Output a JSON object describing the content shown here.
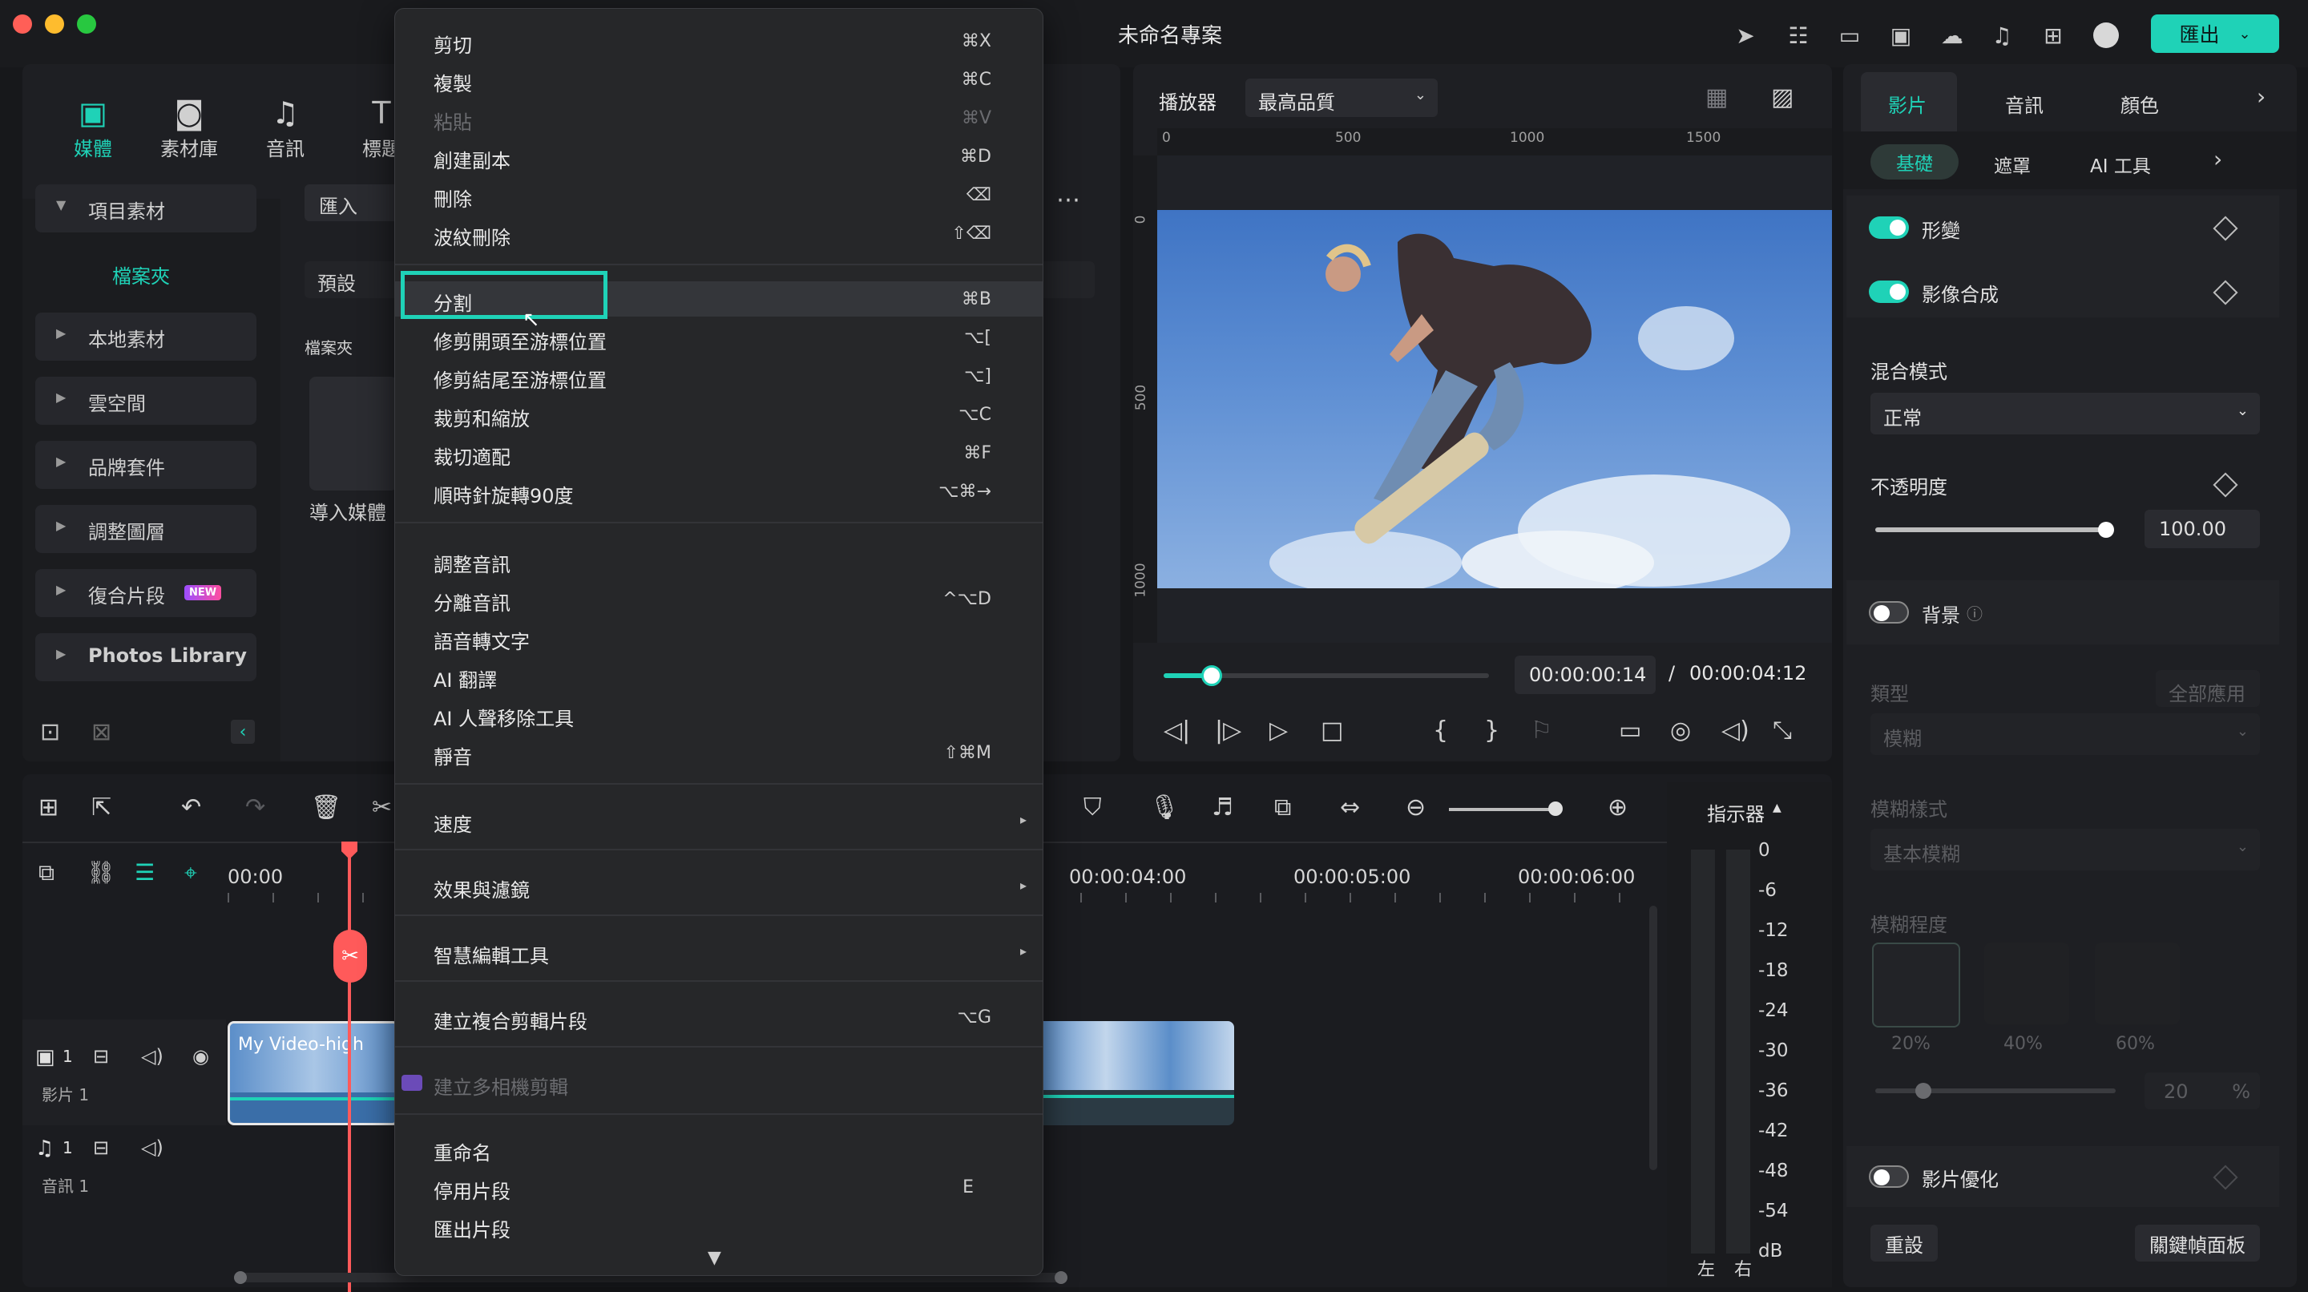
{
  "window": {
    "title": "未命名專案",
    "export_label": "匯出"
  },
  "media_tabs": [
    {
      "label": "媒體",
      "icon": "media-icon"
    },
    {
      "label": "素材庫",
      "icon": "stock-icon"
    },
    {
      "label": "音訊",
      "icon": "music-icon"
    },
    {
      "label": "標題",
      "icon": "title-icon"
    }
  ],
  "sidebar": {
    "project_media": "項目素材",
    "folder": "檔案夾",
    "items": [
      "本地素材",
      "雲空間",
      "品牌套件",
      "調整圖層",
      "復合片段",
      "Photos Library"
    ],
    "new_badge": "NEW"
  },
  "media_browser": {
    "import_label": "匯入",
    "preset_label": "預設",
    "folder_header": "檔案夾",
    "import_media": "導入媒體"
  },
  "context_menu": {
    "items": [
      {
        "label": "剪切",
        "shortcut": "⌘X"
      },
      {
        "label": "複製",
        "shortcut": "⌘C"
      },
      {
        "label": "粘貼",
        "shortcut": "⌘V"
      },
      {
        "label": "創建副本",
        "shortcut": "⌘D"
      },
      {
        "label": "刪除",
        "shortcut": "⌫"
      },
      {
        "label": "波紋刪除",
        "shortcut": "⇧⌫"
      },
      {
        "label": "分割",
        "shortcut": "⌘B"
      },
      {
        "label": "修剪開頭至游標位置",
        "shortcut": "⌥["
      },
      {
        "label": "修剪結尾至游標位置",
        "shortcut": "⌥]"
      },
      {
        "label": "裁剪和縮放",
        "shortcut": "⌥C"
      },
      {
        "label": "裁切適配",
        "shortcut": "⌘F"
      },
      {
        "label": "順時針旋轉90度",
        "shortcut": "⌥⌘→"
      },
      {
        "label": "調整音訊",
        "shortcut": ""
      },
      {
        "label": "分離音訊",
        "shortcut": "^⌥D"
      },
      {
        "label": "語音轉文字",
        "shortcut": ""
      },
      {
        "label": "AI 翻譯",
        "shortcut": ""
      },
      {
        "label": "AI 人聲移除工具",
        "shortcut": ""
      },
      {
        "label": "靜音",
        "shortcut": "⇧⌘M"
      },
      {
        "label": "速度",
        "shortcut": ""
      },
      {
        "label": "效果與濾鏡",
        "shortcut": ""
      },
      {
        "label": "智慧編輯工具",
        "shortcut": ""
      },
      {
        "label": "建立複合剪輯片段",
        "shortcut": "⌥G"
      },
      {
        "label": "建立多相機剪輯",
        "shortcut": ""
      },
      {
        "label": "重命名",
        "shortcut": ""
      },
      {
        "label": "停用片段",
        "shortcut": "E"
      },
      {
        "label": "匯出片段",
        "shortcut": ""
      }
    ],
    "more_arrow": "▼"
  },
  "player": {
    "label": "播放器",
    "quality": "最高品質",
    "ruler_top": [
      "0",
      "500",
      "1000",
      "1500"
    ],
    "ruler_left": [
      "0",
      "500",
      "1000"
    ],
    "current_time": "00:00:00:14",
    "separator": "/",
    "total_time": "00:00:04:12",
    "progress": 0.14
  },
  "inspector": {
    "tabs": [
      "影片",
      "音訊",
      "顏色"
    ],
    "subtabs": [
      "基礎",
      "遮罩",
      "AI 工具"
    ],
    "transform": "形變",
    "compositing": "影像合成",
    "blend_mode_label": "混合模式",
    "blend_mode_value": "正常",
    "opacity_label": "不透明度",
    "opacity_value": "100.00",
    "background_label": "背景",
    "type_label": "類型",
    "apply_all": "全部應用",
    "type_value": "模糊",
    "blur_style_label": "模糊樣式",
    "blur_style_value": "基本模糊",
    "blur_degree_label": "模糊程度",
    "blur_presets": [
      "20%",
      "40%",
      "60%"
    ],
    "blur_value": "20",
    "blur_unit": "%",
    "enhance_label": "影片優化",
    "reset_label": "重設",
    "keyframe_panel": "關鍵幀面板"
  },
  "timeline": {
    "ruler": [
      "00:00",
      "00:00:04:00",
      "00:00:05:00",
      "00:00:06:00"
    ],
    "meter_label": "指示器",
    "meter_scale": [
      "0",
      "-6",
      "-12",
      "-18",
      "-24",
      "-30",
      "-36",
      "-42",
      "-48",
      "-54",
      "dB"
    ],
    "meter_lr": [
      "左",
      "右"
    ],
    "video_track": {
      "number": "1",
      "name": "影片 1"
    },
    "audio_track": {
      "number": "1",
      "name": "音訊 1"
    },
    "clip_name": "My Video-high"
  },
  "colors": {
    "accent": "#1fd2b7",
    "playhead": "#ff5a5a",
    "panel": "#1e1f23",
    "menu": "#262729"
  }
}
